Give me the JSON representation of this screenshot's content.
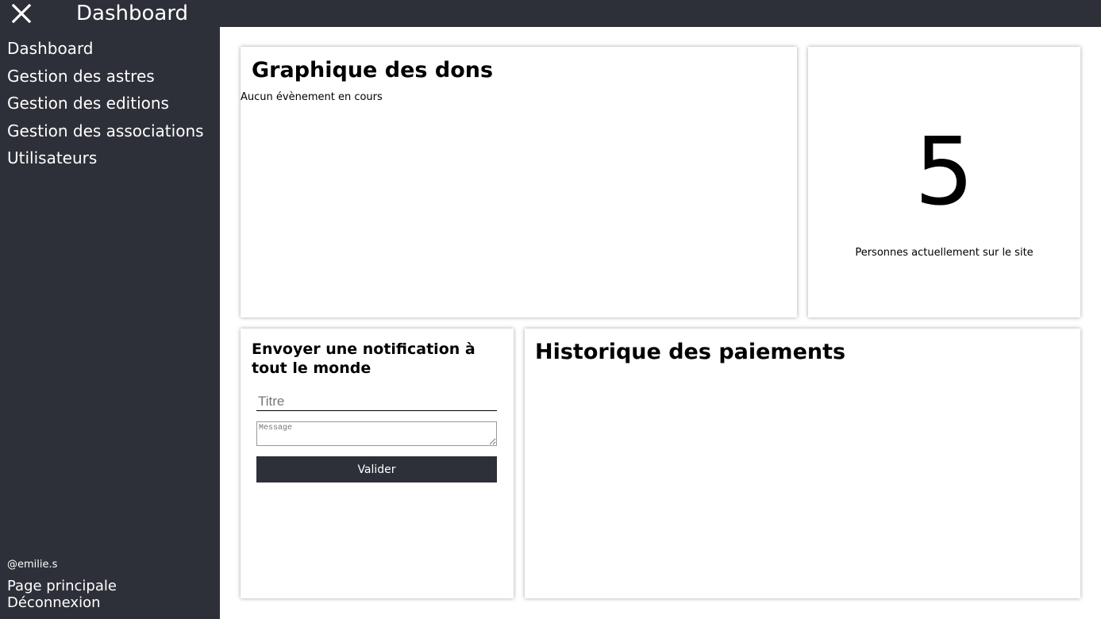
{
  "header": {
    "close_icon": "close-icon",
    "title": "Dashboard"
  },
  "sidebar": {
    "items": [
      {
        "label": "Dashboard"
      },
      {
        "label": "Gestion des astres"
      },
      {
        "label": "Gestion des editions"
      },
      {
        "label": "Gestion des associations"
      },
      {
        "label": "Utilisateurs"
      }
    ],
    "username": "@emilie.s",
    "links": [
      {
        "label": "Page principale"
      },
      {
        "label": "Déconnexion"
      }
    ]
  },
  "donations": {
    "title": "Graphique des dons",
    "empty_message": "Aucun évènement en cours"
  },
  "visitors": {
    "count": "5",
    "label": "Personnes actuellement sur le site"
  },
  "notification": {
    "title": "Envoyer une notification à tout le monde",
    "title_placeholder": "Titre",
    "message_placeholder": "Message",
    "submit_label": "Valider"
  },
  "payments": {
    "title": "Historique des paiements"
  },
  "colors": {
    "dark": "#2d3038",
    "background": "#ffffff"
  }
}
